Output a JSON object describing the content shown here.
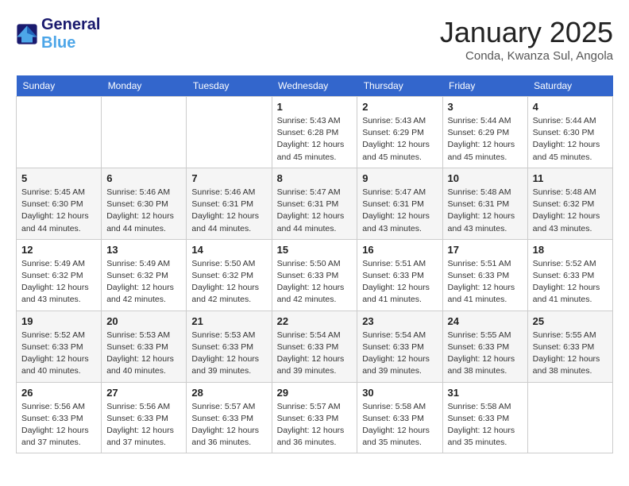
{
  "header": {
    "logo_general": "General",
    "logo_blue": "Blue",
    "month_year": "January 2025",
    "location": "Conda, Kwanza Sul, Angola"
  },
  "days_of_week": [
    "Sunday",
    "Monday",
    "Tuesday",
    "Wednesday",
    "Thursday",
    "Friday",
    "Saturday"
  ],
  "weeks": [
    [
      {
        "day": "",
        "info": ""
      },
      {
        "day": "",
        "info": ""
      },
      {
        "day": "",
        "info": ""
      },
      {
        "day": "1",
        "info": "Sunrise: 5:43 AM\nSunset: 6:28 PM\nDaylight: 12 hours and 45 minutes."
      },
      {
        "day": "2",
        "info": "Sunrise: 5:43 AM\nSunset: 6:29 PM\nDaylight: 12 hours and 45 minutes."
      },
      {
        "day": "3",
        "info": "Sunrise: 5:44 AM\nSunset: 6:29 PM\nDaylight: 12 hours and 45 minutes."
      },
      {
        "day": "4",
        "info": "Sunrise: 5:44 AM\nSunset: 6:30 PM\nDaylight: 12 hours and 45 minutes."
      }
    ],
    [
      {
        "day": "5",
        "info": "Sunrise: 5:45 AM\nSunset: 6:30 PM\nDaylight: 12 hours and 44 minutes."
      },
      {
        "day": "6",
        "info": "Sunrise: 5:46 AM\nSunset: 6:30 PM\nDaylight: 12 hours and 44 minutes."
      },
      {
        "day": "7",
        "info": "Sunrise: 5:46 AM\nSunset: 6:31 PM\nDaylight: 12 hours and 44 minutes."
      },
      {
        "day": "8",
        "info": "Sunrise: 5:47 AM\nSunset: 6:31 PM\nDaylight: 12 hours and 44 minutes."
      },
      {
        "day": "9",
        "info": "Sunrise: 5:47 AM\nSunset: 6:31 PM\nDaylight: 12 hours and 43 minutes."
      },
      {
        "day": "10",
        "info": "Sunrise: 5:48 AM\nSunset: 6:31 PM\nDaylight: 12 hours and 43 minutes."
      },
      {
        "day": "11",
        "info": "Sunrise: 5:48 AM\nSunset: 6:32 PM\nDaylight: 12 hours and 43 minutes."
      }
    ],
    [
      {
        "day": "12",
        "info": "Sunrise: 5:49 AM\nSunset: 6:32 PM\nDaylight: 12 hours and 43 minutes."
      },
      {
        "day": "13",
        "info": "Sunrise: 5:49 AM\nSunset: 6:32 PM\nDaylight: 12 hours and 42 minutes."
      },
      {
        "day": "14",
        "info": "Sunrise: 5:50 AM\nSunset: 6:32 PM\nDaylight: 12 hours and 42 minutes."
      },
      {
        "day": "15",
        "info": "Sunrise: 5:50 AM\nSunset: 6:33 PM\nDaylight: 12 hours and 42 minutes."
      },
      {
        "day": "16",
        "info": "Sunrise: 5:51 AM\nSunset: 6:33 PM\nDaylight: 12 hours and 41 minutes."
      },
      {
        "day": "17",
        "info": "Sunrise: 5:51 AM\nSunset: 6:33 PM\nDaylight: 12 hours and 41 minutes."
      },
      {
        "day": "18",
        "info": "Sunrise: 5:52 AM\nSunset: 6:33 PM\nDaylight: 12 hours and 41 minutes."
      }
    ],
    [
      {
        "day": "19",
        "info": "Sunrise: 5:52 AM\nSunset: 6:33 PM\nDaylight: 12 hours and 40 minutes."
      },
      {
        "day": "20",
        "info": "Sunrise: 5:53 AM\nSunset: 6:33 PM\nDaylight: 12 hours and 40 minutes."
      },
      {
        "day": "21",
        "info": "Sunrise: 5:53 AM\nSunset: 6:33 PM\nDaylight: 12 hours and 39 minutes."
      },
      {
        "day": "22",
        "info": "Sunrise: 5:54 AM\nSunset: 6:33 PM\nDaylight: 12 hours and 39 minutes."
      },
      {
        "day": "23",
        "info": "Sunrise: 5:54 AM\nSunset: 6:33 PM\nDaylight: 12 hours and 39 minutes."
      },
      {
        "day": "24",
        "info": "Sunrise: 5:55 AM\nSunset: 6:33 PM\nDaylight: 12 hours and 38 minutes."
      },
      {
        "day": "25",
        "info": "Sunrise: 5:55 AM\nSunset: 6:33 PM\nDaylight: 12 hours and 38 minutes."
      }
    ],
    [
      {
        "day": "26",
        "info": "Sunrise: 5:56 AM\nSunset: 6:33 PM\nDaylight: 12 hours and 37 minutes."
      },
      {
        "day": "27",
        "info": "Sunrise: 5:56 AM\nSunset: 6:33 PM\nDaylight: 12 hours and 37 minutes."
      },
      {
        "day": "28",
        "info": "Sunrise: 5:57 AM\nSunset: 6:33 PM\nDaylight: 12 hours and 36 minutes."
      },
      {
        "day": "29",
        "info": "Sunrise: 5:57 AM\nSunset: 6:33 PM\nDaylight: 12 hours and 36 minutes."
      },
      {
        "day": "30",
        "info": "Sunrise: 5:58 AM\nSunset: 6:33 PM\nDaylight: 12 hours and 35 minutes."
      },
      {
        "day": "31",
        "info": "Sunrise: 5:58 AM\nSunset: 6:33 PM\nDaylight: 12 hours and 35 minutes."
      },
      {
        "day": "",
        "info": ""
      }
    ]
  ]
}
